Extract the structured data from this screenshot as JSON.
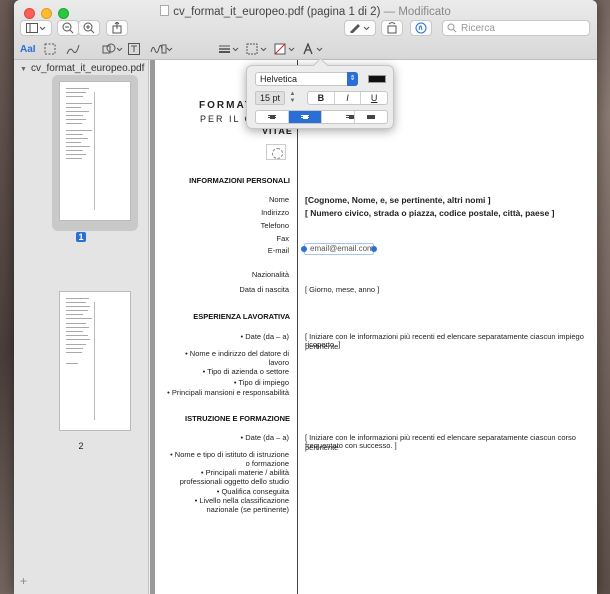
{
  "window": {
    "filename": "cv_format_it_europeo.pdf",
    "page_info": "(pagina 1 di 2)",
    "status": "— Modificato"
  },
  "toolbar": {
    "search_placeholder": "Ricerca",
    "text_style_label": "AaI"
  },
  "sidebar": {
    "document_name": "cv_format_it_europeo.pdf",
    "pages": [
      {
        "label": "1",
        "selected": true
      },
      {
        "label": "2",
        "selected": false
      }
    ]
  },
  "format_popover": {
    "font": "Helvetica",
    "size": "15 pt",
    "bold_label": "B",
    "italic_label": "I",
    "underline_label": "U",
    "color": "#111111",
    "alignment_selected": "center"
  },
  "document": {
    "header_line1": "Format",
    "header_line2": "per il c",
    "header_vitae": "vitae",
    "section_personal": "Informazioni personali",
    "personal_labels": [
      "Nome",
      "Indirizzo",
      "Telefono",
      "Fax",
      "E-mail",
      "Nazionalità",
      "Data di nascita"
    ],
    "name_value": "[Cognome, Nome, e, se pertinente, altri nomi ]",
    "address_value": "[ Numero civico, strada o piazza, codice postale, città, paese ]",
    "email_value": "email@email.com",
    "birth_value": "[ Giorno, mese, anno ]",
    "section_work": "Esperienza lavorativa",
    "work_labels": [
      "• Date (da – a)",
      "• Nome e indirizzo del datore di",
      "lavoro",
      "• Tipo di azienda o settore",
      "• Tipo di impiego",
      "• Principali mansioni e responsabilità"
    ],
    "work_value_1": "[ Iniziare con le informazioni più recenti ed elencare separatamente ciascun impiego pertinente",
    "work_value_2": "ricoperto. ]",
    "section_education": "Istruzione e formazione",
    "edu_labels": [
      "• Date (da – a)",
      "• Nome e tipo di istituto di istruzione",
      "o formazione",
      "• Principali materie / abilità",
      "professionali oggetto dello studio",
      "• Qualifica conseguita",
      "• Livello nella classificazione",
      "nazionale (se pertinente)"
    ],
    "edu_value_1": "[ Iniziare con le informazioni più recenti ed elencare separatamente ciascun corso pertinente",
    "edu_value_2": "frequentato con successo. ]"
  }
}
